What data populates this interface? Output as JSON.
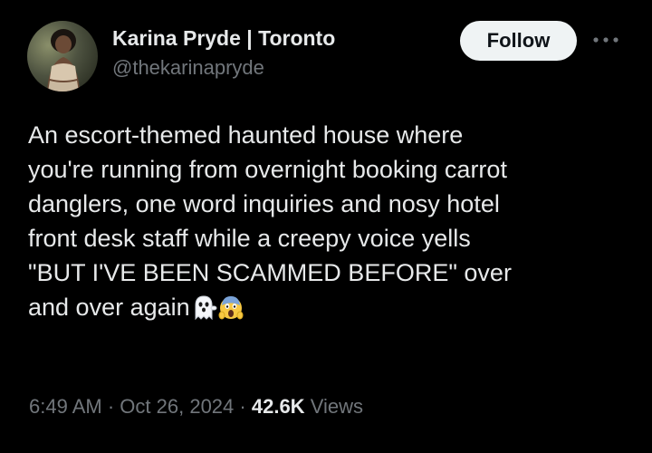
{
  "tweet": {
    "author": {
      "name": "Karina Pryde | Toronto",
      "handle": "@thekarinapryde",
      "avatar_icon": "profile-photo"
    },
    "follow_label": "Follow",
    "more_icon": "more-horizontal-icon",
    "text_lines": [
      "An escort-themed haunted house where",
      "you're running from overnight booking carrot",
      "danglers, one word inquiries and nosy hotel",
      "front desk staff while a creepy voice yells",
      "\"BUT I'VE BEEN SCAMMED BEFORE\" over",
      "and over again"
    ],
    "emojis": [
      "ghost-emoji",
      "screaming-face-emoji"
    ],
    "time": "6:49 AM",
    "separator": "·",
    "date": "Oct 26, 2024",
    "views_count": "42.6K",
    "views_label": "Views"
  },
  "colors": {
    "background": "#000000",
    "primary_text": "#e7e9ea",
    "secondary_text": "#71767b",
    "follow_bg": "#eff3f4",
    "follow_text": "#0f1419"
  }
}
